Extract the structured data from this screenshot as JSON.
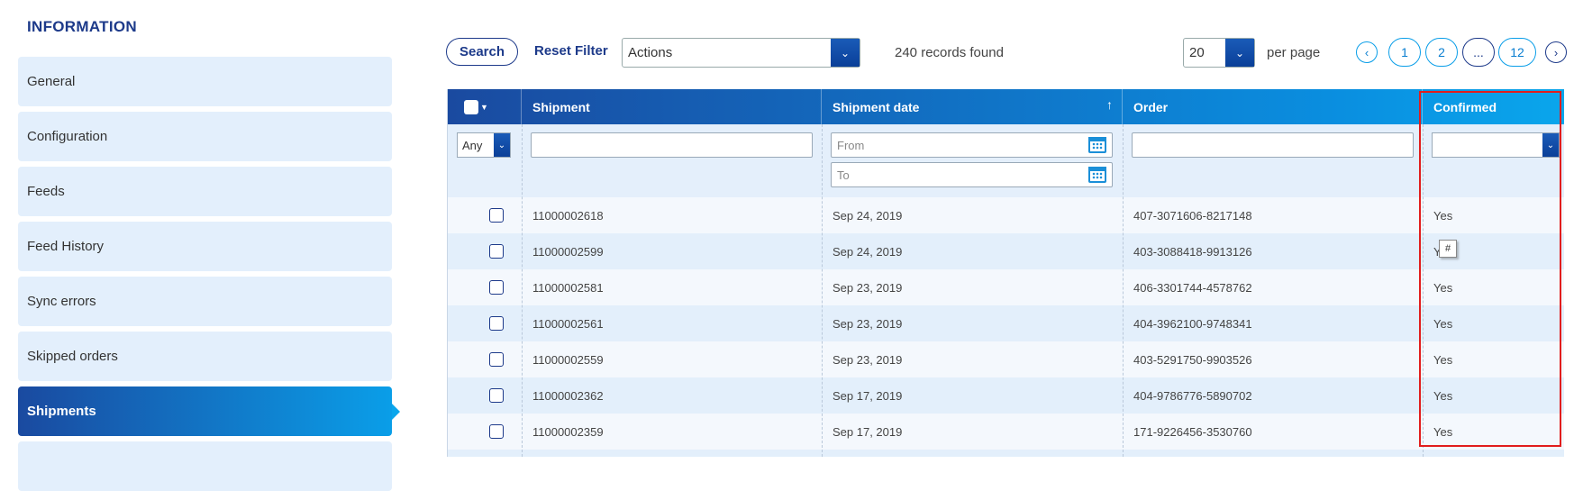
{
  "sidebar": {
    "title": "INFORMATION",
    "items": [
      {
        "label": "General"
      },
      {
        "label": "Configuration"
      },
      {
        "label": "Feeds"
      },
      {
        "label": "Feed History"
      },
      {
        "label": "Sync errors"
      },
      {
        "label": "Skipped orders"
      },
      {
        "label": "Shipments"
      }
    ],
    "active": "Shipments"
  },
  "toolbar": {
    "search_label": "Search",
    "reset_label": "Reset Filter",
    "actions_value": "Actions",
    "records_text": "240 records found",
    "per_page_value": "20",
    "per_page_label": "per page"
  },
  "pagination": {
    "pages": [
      "1",
      "2",
      "...",
      "12"
    ]
  },
  "table": {
    "headers": {
      "shipment": "Shipment",
      "shipment_date": "Shipment date",
      "order": "Order",
      "confirmed": "Confirmed"
    },
    "filters": {
      "any_value": "Any",
      "from_placeholder": "From",
      "to_placeholder": "To"
    },
    "rows": [
      {
        "shipment": "11000002618",
        "date": "Sep 24, 2019",
        "order": "407-3071606-8217148",
        "confirmed": "Yes"
      },
      {
        "shipment": "11000002599",
        "date": "Sep 24, 2019",
        "order": "403-3088418-9913126",
        "confirmed": "Y"
      },
      {
        "shipment": "11000002581",
        "date": "Sep 23, 2019",
        "order": "406-3301744-4578762",
        "confirmed": "Yes"
      },
      {
        "shipment": "11000002561",
        "date": "Sep 23, 2019",
        "order": "404-3962100-9748341",
        "confirmed": "Yes"
      },
      {
        "shipment": "11000002559",
        "date": "Sep 23, 2019",
        "order": "403-5291750-9903526",
        "confirmed": "Yes"
      },
      {
        "shipment": "11000002362",
        "date": "Sep 17, 2019",
        "order": "404-9786776-5890702",
        "confirmed": "Yes"
      },
      {
        "shipment": "11000002359",
        "date": "Sep 17, 2019",
        "order": "171-9226456-3530760",
        "confirmed": "Yes"
      }
    ]
  },
  "tooltip": {
    "text": "#"
  },
  "colors": {
    "brand_dark": "#1d3a8a",
    "brand_light": "#0aa6ec",
    "highlight": "#e11d1d",
    "row_alt": "#e3effb"
  }
}
